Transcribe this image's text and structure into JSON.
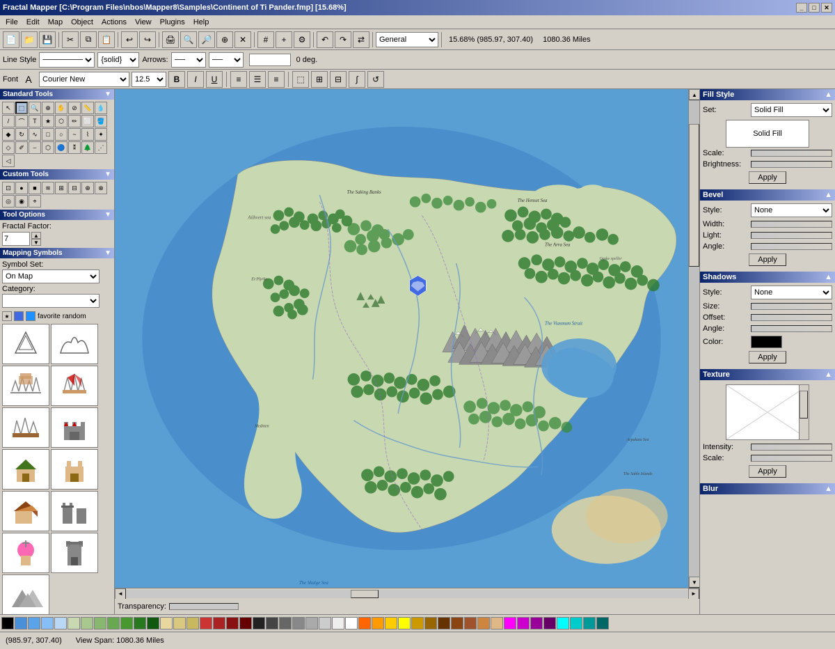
{
  "titlebar": {
    "title": "Fractal Mapper [C:\\Program Files\\nbos\\Mapper8\\Samples\\Continent of Ti Pander.fmp] [15.68%]",
    "buttons": [
      "_",
      "□",
      "✕"
    ]
  },
  "menubar": {
    "items": [
      "File",
      "Edit",
      "Map",
      "Object",
      "Actions",
      "View",
      "Plugins",
      "Help"
    ]
  },
  "toolbar1": {
    "zoom_display": "15.68% (985.97, 307.40)",
    "distance_display": "1080.36 Miles",
    "layer_select": "General"
  },
  "toolbar2": {
    "line_style_label": "Line Style",
    "line_style_value": "solid",
    "arrows_label": "Arrows:",
    "angle_value": "0 deg."
  },
  "toolbar3": {
    "font_label": "Font",
    "font_name": "Courier New",
    "font_size": "12.5"
  },
  "left_panel": {
    "standard_tools_header": "Standard Tools",
    "custom_tools_header": "Custom Tools",
    "tool_options_header": "Tool Options",
    "fractal_factor_label": "Fractal Factor:",
    "fractal_factor_value": "7",
    "mapping_symbols_header": "Mapping Symbols",
    "symbol_set_label": "Symbol Set:",
    "symbol_set_value": "On Map",
    "category_label": "Category:",
    "filter_labels": [
      "favorite",
      "random"
    ]
  },
  "right_panel": {
    "fill_style_header": "Fill Style",
    "set_label": "Set:",
    "set_value": "Solid Fill",
    "fill_preview_text": "Solid Fill",
    "scale_label": "Scale:",
    "brightness_label": "Brightness:",
    "apply_label": "Apply",
    "bevel_header": "Bevel",
    "bevel_style_label": "Style:",
    "bevel_style_value": "None",
    "bevel_width_label": "Width:",
    "bevel_light_label": "Light:",
    "bevel_angle_label": "Angle:",
    "shadows_header": "Shadows",
    "shadow_style_label": "Style:",
    "shadow_style_value": "None",
    "shadow_size_label": "Size:",
    "shadow_offset_label": "Offset:",
    "shadow_angle_label": "Angle:",
    "shadow_color_label": "Color:",
    "texture_header": "Texture",
    "texture_intensity_label": "Intensity:",
    "texture_scale_label": "Scale:",
    "blur_header": "Blur"
  },
  "statusbar": {
    "coordinates": "(985.97, 307.40)",
    "view_span": "View Span: 1080.36 Miles"
  },
  "palette_colors": [
    "#FFFFFF",
    "#F0F0F0",
    "#D0D0D0",
    "#B0B0B0",
    "#909090",
    "#707070",
    "#505050",
    "#303030",
    "#000000",
    "#FF0000",
    "#CC0000",
    "#990000",
    "#FF6666",
    "#FFAAAA",
    "#00FF00",
    "#00CC00",
    "#009900",
    "#66FF66",
    "#0000FF",
    "#0000CC",
    "#000099",
    "#6666FF",
    "#FFFF00",
    "#CCCC00",
    "#FF8800",
    "#FFCC00",
    "#FF00FF",
    "#CC00CC",
    "#00FFFF",
    "#00CCCC",
    "#8B4513",
    "#A0522D",
    "#CD853F",
    "#DEB887",
    "#228B22",
    "#006400",
    "#90EE90",
    "#98FB98",
    "#4169E1",
    "#1E90FF",
    "#87CEEB",
    "#B0E0E6",
    "#FF69B4",
    "#FF1493",
    "#DB7093"
  ],
  "map": {
    "title": "Continent of Ti Pander"
  }
}
